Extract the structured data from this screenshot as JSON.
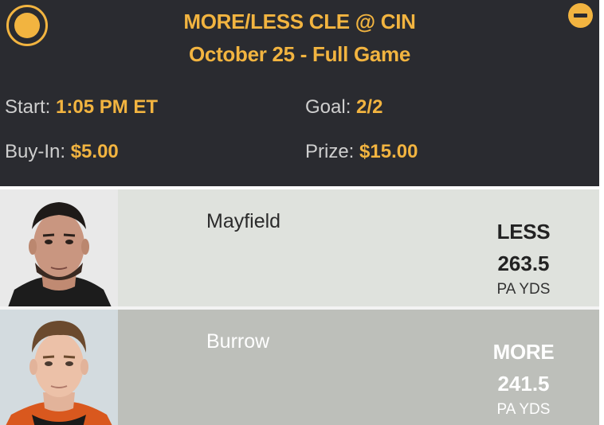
{
  "contest": {
    "title": "MORE/LESS CLE @ CIN",
    "subtitle": "October 25 - Full Game",
    "start_label": "Start:",
    "start_value": "1:05 PM ET",
    "goal_label": "Goal:",
    "goal_value": "2/2",
    "buyin_label": "Buy-In:",
    "buyin_value": "$5.00",
    "prize_label": "Prize:",
    "prize_value": "$15.00"
  },
  "picks": [
    {
      "name": "Mayfield",
      "pick": "LESS",
      "line": "263.5",
      "stat": "PA YDS"
    },
    {
      "name": "Burrow",
      "pick": "MORE",
      "line": "241.5",
      "stat": "PA YDS"
    }
  ],
  "colors": {
    "accent": "#f2b440",
    "header_bg": "#2a2b30",
    "row1_bg": "#dfe2dd",
    "row2_bg": "#bdbfba"
  },
  "icons": {
    "select": "radio-selected-icon",
    "collapse": "minus-circle-icon"
  }
}
